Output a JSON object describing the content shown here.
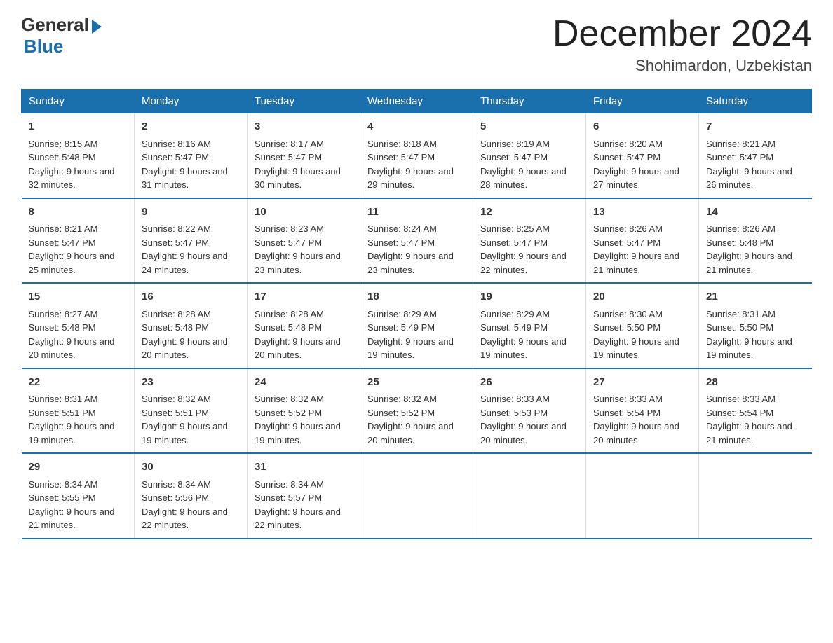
{
  "logo": {
    "general": "General",
    "blue": "Blue"
  },
  "title": "December 2024",
  "location": "Shohimardon, Uzbekistan",
  "weekdays": [
    "Sunday",
    "Monday",
    "Tuesday",
    "Wednesday",
    "Thursday",
    "Friday",
    "Saturday"
  ],
  "weeks": [
    [
      {
        "day": "1",
        "sunrise": "8:15 AM",
        "sunset": "5:48 PM",
        "daylight": "9 hours and 32 minutes."
      },
      {
        "day": "2",
        "sunrise": "8:16 AM",
        "sunset": "5:47 PM",
        "daylight": "9 hours and 31 minutes."
      },
      {
        "day": "3",
        "sunrise": "8:17 AM",
        "sunset": "5:47 PM",
        "daylight": "9 hours and 30 minutes."
      },
      {
        "day": "4",
        "sunrise": "8:18 AM",
        "sunset": "5:47 PM",
        "daylight": "9 hours and 29 minutes."
      },
      {
        "day": "5",
        "sunrise": "8:19 AM",
        "sunset": "5:47 PM",
        "daylight": "9 hours and 28 minutes."
      },
      {
        "day": "6",
        "sunrise": "8:20 AM",
        "sunset": "5:47 PM",
        "daylight": "9 hours and 27 minutes."
      },
      {
        "day": "7",
        "sunrise": "8:21 AM",
        "sunset": "5:47 PM",
        "daylight": "9 hours and 26 minutes."
      }
    ],
    [
      {
        "day": "8",
        "sunrise": "8:21 AM",
        "sunset": "5:47 PM",
        "daylight": "9 hours and 25 minutes."
      },
      {
        "day": "9",
        "sunrise": "8:22 AM",
        "sunset": "5:47 PM",
        "daylight": "9 hours and 24 minutes."
      },
      {
        "day": "10",
        "sunrise": "8:23 AM",
        "sunset": "5:47 PM",
        "daylight": "9 hours and 23 minutes."
      },
      {
        "day": "11",
        "sunrise": "8:24 AM",
        "sunset": "5:47 PM",
        "daylight": "9 hours and 23 minutes."
      },
      {
        "day": "12",
        "sunrise": "8:25 AM",
        "sunset": "5:47 PM",
        "daylight": "9 hours and 22 minutes."
      },
      {
        "day": "13",
        "sunrise": "8:26 AM",
        "sunset": "5:47 PM",
        "daylight": "9 hours and 21 minutes."
      },
      {
        "day": "14",
        "sunrise": "8:26 AM",
        "sunset": "5:48 PM",
        "daylight": "9 hours and 21 minutes."
      }
    ],
    [
      {
        "day": "15",
        "sunrise": "8:27 AM",
        "sunset": "5:48 PM",
        "daylight": "9 hours and 20 minutes."
      },
      {
        "day": "16",
        "sunrise": "8:28 AM",
        "sunset": "5:48 PM",
        "daylight": "9 hours and 20 minutes."
      },
      {
        "day": "17",
        "sunrise": "8:28 AM",
        "sunset": "5:48 PM",
        "daylight": "9 hours and 20 minutes."
      },
      {
        "day": "18",
        "sunrise": "8:29 AM",
        "sunset": "5:49 PM",
        "daylight": "9 hours and 19 minutes."
      },
      {
        "day": "19",
        "sunrise": "8:29 AM",
        "sunset": "5:49 PM",
        "daylight": "9 hours and 19 minutes."
      },
      {
        "day": "20",
        "sunrise": "8:30 AM",
        "sunset": "5:50 PM",
        "daylight": "9 hours and 19 minutes."
      },
      {
        "day": "21",
        "sunrise": "8:31 AM",
        "sunset": "5:50 PM",
        "daylight": "9 hours and 19 minutes."
      }
    ],
    [
      {
        "day": "22",
        "sunrise": "8:31 AM",
        "sunset": "5:51 PM",
        "daylight": "9 hours and 19 minutes."
      },
      {
        "day": "23",
        "sunrise": "8:32 AM",
        "sunset": "5:51 PM",
        "daylight": "9 hours and 19 minutes."
      },
      {
        "day": "24",
        "sunrise": "8:32 AM",
        "sunset": "5:52 PM",
        "daylight": "9 hours and 19 minutes."
      },
      {
        "day": "25",
        "sunrise": "8:32 AM",
        "sunset": "5:52 PM",
        "daylight": "9 hours and 20 minutes."
      },
      {
        "day": "26",
        "sunrise": "8:33 AM",
        "sunset": "5:53 PM",
        "daylight": "9 hours and 20 minutes."
      },
      {
        "day": "27",
        "sunrise": "8:33 AM",
        "sunset": "5:54 PM",
        "daylight": "9 hours and 20 minutes."
      },
      {
        "day": "28",
        "sunrise": "8:33 AM",
        "sunset": "5:54 PM",
        "daylight": "9 hours and 21 minutes."
      }
    ],
    [
      {
        "day": "29",
        "sunrise": "8:34 AM",
        "sunset": "5:55 PM",
        "daylight": "9 hours and 21 minutes."
      },
      {
        "day": "30",
        "sunrise": "8:34 AM",
        "sunset": "5:56 PM",
        "daylight": "9 hours and 22 minutes."
      },
      {
        "day": "31",
        "sunrise": "8:34 AM",
        "sunset": "5:57 PM",
        "daylight": "9 hours and 22 minutes."
      },
      null,
      null,
      null,
      null
    ]
  ]
}
